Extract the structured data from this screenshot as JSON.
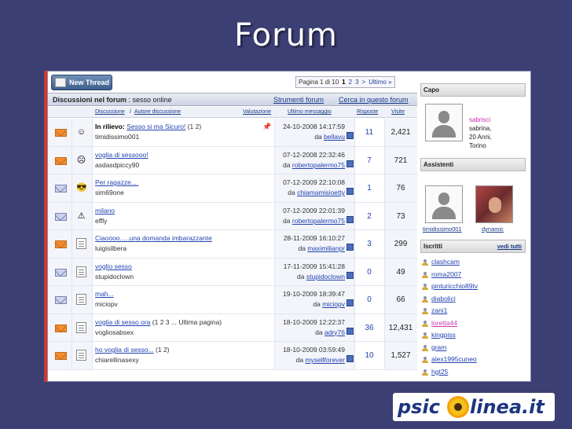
{
  "slide_title": "Forum",
  "toolbar": {
    "new_thread": "New Thread"
  },
  "pager": {
    "label": "Pagina 1 di 10",
    "current": "1",
    "p2": "2",
    "p3": "3",
    "next": ">",
    "last": "Ultimo »"
  },
  "forum": {
    "prefix": "Discussioni nel forum",
    "name": ": sesso online",
    "tools": "Strumenti forum",
    "search": "Cerca in questo forum"
  },
  "columns": {
    "discussione": "Discussione",
    "sep": "/",
    "autore": "Autore discussione",
    "valutazione": "Valutazione",
    "ultimo": "Ultimo messaggio",
    "risposte": "Risposte",
    "visite": "Visite"
  },
  "threads": [
    {
      "prefix": "In rilievo:",
      "title": "Sesso si ma Sicuro!",
      "pages": "(1 2)",
      "author": "timidissimo001",
      "date": "24-10-2008 14:17:59",
      "by": "da",
      "last": "bellavu",
      "replies": "11",
      "views": "2,421",
      "icon": "hot",
      "ico2": "☺",
      "pinned": true
    },
    {
      "prefix": "",
      "title": "voglia di sessooo!",
      "pages": "",
      "author": "asdasdpiccy90",
      "date": "07-12-2008 22:32:46",
      "by": "da",
      "last": "robertopalermo75",
      "replies": "7",
      "views": "721",
      "icon": "hot",
      "ico2": "☹",
      "pinned": false
    },
    {
      "prefix": "",
      "title": "Per ragazze....",
      "pages": "",
      "author": "sim69one",
      "date": "07-12-2009 22:10:08",
      "by": "da",
      "last": "chiamamisioetty",
      "replies": "1",
      "views": "76",
      "icon": "old",
      "ico2": "😎",
      "pinned": false
    },
    {
      "prefix": "",
      "title": "milano",
      "pages": "",
      "author": "effly",
      "date": "07-12-2009 22:01:39",
      "by": "da",
      "last": "robertopalermo75",
      "replies": "2",
      "views": "73",
      "icon": "old",
      "ico2": "⚠",
      "pinned": false
    },
    {
      "prefix": "",
      "title": "Ciaoooo.....una domanda imbarazzante",
      "pages": "",
      "author": "luigisilbera",
      "date": "28-11-2009 16:10:27",
      "by": "da",
      "last": "maximilianpr",
      "replies": "3",
      "views": "299",
      "icon": "hot",
      "ico2": "doc",
      "pinned": false
    },
    {
      "prefix": "",
      "title": "voglio sesso",
      "pages": "",
      "author": "stupidoclown",
      "date": "17-11-2009 15:41:28",
      "by": "da",
      "last": "stupidoclown",
      "replies": "0",
      "views": "49",
      "icon": "old",
      "ico2": "doc",
      "pinned": false
    },
    {
      "prefix": "",
      "title": "mah...",
      "pages": "",
      "author": "miciopv",
      "date": "19-10-2009 18:39:47",
      "by": "da",
      "last": "miciopv",
      "replies": "0",
      "views": "66",
      "icon": "old",
      "ico2": "doc",
      "pinned": false
    },
    {
      "prefix": "",
      "title": "voglia di sesso ora",
      "pages": "(1 2 3 ... Ultima pagina)",
      "author": "vogliosabsex",
      "date": "18-10-2009 12:22:37",
      "by": "da",
      "last": "adry76",
      "replies": "36",
      "views": "12,431",
      "icon": "hot",
      "ico2": "doc",
      "pinned": false
    },
    {
      "prefix": "",
      "title": "ho voglia di sesso...",
      "pages": "(1 2)",
      "author": "chiarellinasexy",
      "date": "18-10-2009 03:59:49",
      "by": "da",
      "last": "mysellforever",
      "replies": "10",
      "views": "1,527",
      "icon": "hot",
      "ico2": "doc",
      "pinned": false
    }
  ],
  "sidebar": {
    "capo": {
      "title": "Capo",
      "name": "sabrisci",
      "info1": "sabrina,",
      "info2": "20 Anni,",
      "info3": "Torino"
    },
    "assistenti": {
      "title": "Assistenti",
      "a1": "timidissimo001",
      "a2": "dynamic"
    },
    "iscritti": {
      "title": "Iscritti",
      "all": "vedi tutti",
      "members": [
        {
          "name": "clashcam",
          "pink": false
        },
        {
          "name": "roma2007",
          "pink": false
        },
        {
          "name": "pinturicchio89tv",
          "pink": false
        },
        {
          "name": "diabolici",
          "pink": false
        },
        {
          "name": "zani1",
          "pink": false
        },
        {
          "name": "loretta44",
          "pink": true
        },
        {
          "name": "kingpiss",
          "pink": false
        },
        {
          "name": "gram",
          "pink": false
        },
        {
          "name": "alex1995cuneo",
          "pink": false
        },
        {
          "name": "hgt25",
          "pink": false
        }
      ]
    }
  },
  "logo": {
    "left": "psic",
    "right": "linea.it"
  }
}
